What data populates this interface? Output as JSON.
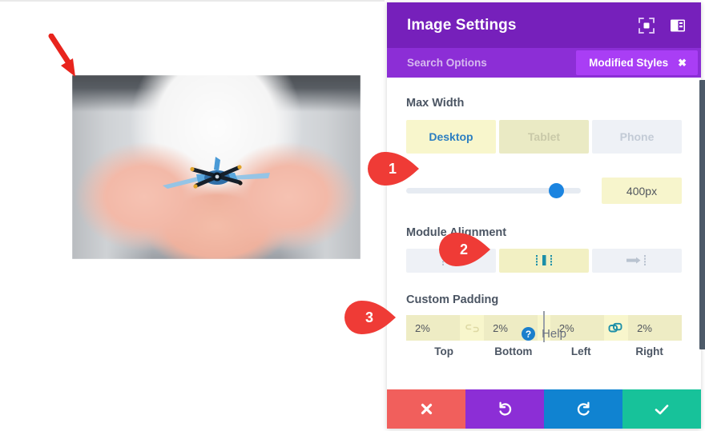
{
  "panel": {
    "title": "Image Settings",
    "header_icons": [
      {
        "name": "focus-expand-icon"
      },
      {
        "name": "layout-panel-icon"
      }
    ],
    "search_placeholder": "Search Options",
    "modified_styles_label": "Modified Styles",
    "modified_styles_close": "✖"
  },
  "max_width": {
    "label": "Max Width",
    "tabs": [
      {
        "label": "Desktop",
        "state": "active"
      },
      {
        "label": "Tablet",
        "state": "modified"
      },
      {
        "label": "Phone",
        "state": "inactive"
      }
    ],
    "slider_value": "400px",
    "slider_percent": 86
  },
  "module_alignment": {
    "label": "Module Alignment",
    "options": [
      {
        "name": "align-left-icon",
        "selected": false
      },
      {
        "name": "align-center-icon",
        "selected": true
      },
      {
        "name": "align-right-icon",
        "selected": false
      }
    ]
  },
  "custom_padding": {
    "label": "Custom Padding",
    "fields": [
      {
        "label": "Top",
        "value": "2%"
      },
      {
        "label": "Bottom",
        "value": "2%"
      },
      {
        "label": "Left",
        "value": "2%"
      },
      {
        "label": "Right",
        "value": "2%"
      }
    ],
    "link_top_bottom": {
      "name": "link-broken-icon",
      "linked": false
    },
    "link_left_right": {
      "name": "link-connected-icon",
      "linked": true
    }
  },
  "help": {
    "label": "Help",
    "icon_glyph": "?"
  },
  "actions": [
    {
      "name": "cancel-button",
      "icon": "close-icon",
      "color": "#f15f5c"
    },
    {
      "name": "undo-button",
      "icon": "undo-icon",
      "color": "#8c2ed6"
    },
    {
      "name": "redo-button",
      "icon": "redo-icon",
      "color": "#1083d1"
    },
    {
      "name": "save-button",
      "icon": "check-icon",
      "color": "#17c29a"
    }
  ],
  "callouts": [
    {
      "number": "1"
    },
    {
      "number": "2"
    },
    {
      "number": "3"
    }
  ],
  "canvas": {
    "image_alt": "child hands holding toy airplane",
    "arrow_name": "red-arrow-pointing-to-image-corner"
  },
  "colors": {
    "header_purple": "#7620bb",
    "subbar_purple": "#8c2ed6",
    "badge_purple": "#a93ef5",
    "accent_yellow": "#f8f6cc",
    "accent_blue": "#1b84e0",
    "callout_red": "#ef3b36"
  }
}
